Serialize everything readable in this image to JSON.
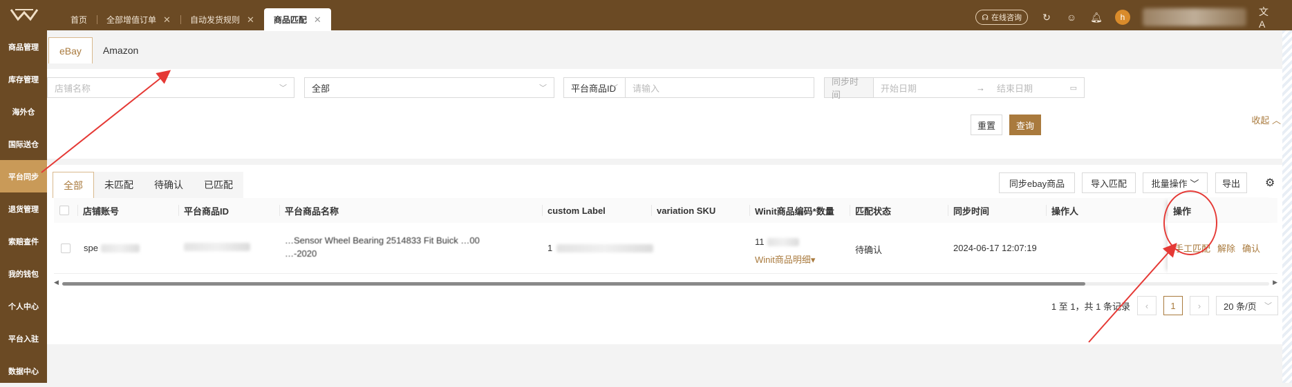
{
  "tabs": [
    {
      "label": "首页",
      "closable": false
    },
    {
      "label": "全部增值订单",
      "closable": true
    },
    {
      "label": "自动发货规则",
      "closable": true
    },
    {
      "label": "商品匹配",
      "closable": true,
      "active": true
    }
  ],
  "top_right": {
    "consult_label": "在线咨询",
    "avatar_letter": "h",
    "user": "wan.gan6@winit"
  },
  "sidebar": [
    "商品管理",
    "库存管理",
    "海外仓",
    "国际送仓",
    "平台同步",
    "退货管理",
    "索赔查件",
    "我的钱包",
    "个人中心",
    "平台入驻",
    "数据中心"
  ],
  "sidebar_active_index": 4,
  "platform_tabs": [
    "eBay",
    "Amazon"
  ],
  "filters": {
    "shop_placeholder": "店铺名称",
    "status_value": "全部",
    "id_type": "平台商品ID",
    "id_placeholder": "请输入",
    "sync_label": "同步时间",
    "start_placeholder": "开始日期",
    "arrow": "→",
    "end_placeholder": "结束日期",
    "reset": "重置",
    "query": "查询",
    "collapse": "收起"
  },
  "status_tabs": [
    "全部",
    "未匹配",
    "待确认",
    "已匹配"
  ],
  "toolbar": {
    "sync": "同步ebay商品",
    "import": "导入匹配",
    "batch": "批量操作",
    "export": "导出"
  },
  "columns": [
    "店铺账号",
    "平台商品ID",
    "平台商品名称",
    "custom Label",
    "variation SKU",
    "Winit商品编码*数量",
    "匹配状态",
    "同步时间",
    "操作人",
    "操作"
  ],
  "row": {
    "shop": "spe",
    "title_line1": "…Sensor Wheel Bearing 2514833 Fit Buick …00",
    "title_line2": "…-2020",
    "custom_label": "1",
    "winit_code": "11",
    "winit_detail": "Winit商品明细",
    "status": "待确认",
    "sync_time": "2024-06-17 12:07:19",
    "actions": [
      "手工匹配",
      "解除",
      "确认"
    ]
  },
  "pager": {
    "summary": "1 至 1，共 1 条记录",
    "current": "1",
    "page_size": "20 条/页"
  },
  "colors": {
    "brand": "#6b4a24",
    "accent": "#a97a3d",
    "annotation": "#e53935"
  }
}
